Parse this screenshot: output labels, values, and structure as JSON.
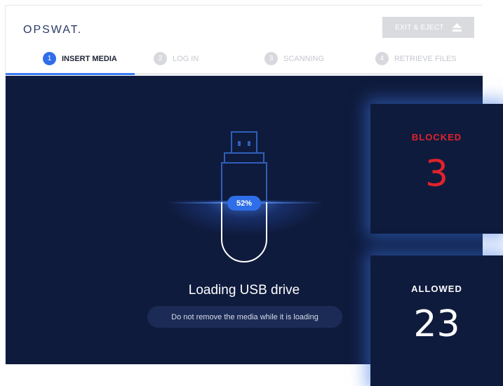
{
  "header": {
    "logo": "OPSWAT.",
    "exit_label": "EXIT & EJECT"
  },
  "steps": [
    {
      "number": "1",
      "label": "INSERT MEDIA",
      "active": true
    },
    {
      "number": "2",
      "label": "LOG IN",
      "active": false
    },
    {
      "number": "3",
      "label": "SCANNING",
      "active": false
    },
    {
      "number": "4",
      "label": "RETRIEVE FILES",
      "active": false
    }
  ],
  "progress": {
    "step_fraction": 0.27
  },
  "main": {
    "percent": "52%",
    "title": "Loading USB drive",
    "note": "Do not remove the media while it is loading"
  },
  "counters": {
    "blocked_label": "BLOCKED",
    "blocked_value": "3",
    "allowed_label": "ALLOWED",
    "allowed_value": "23"
  },
  "colors": {
    "accent": "#2f6ee8",
    "background_dark": "#0f1b3d",
    "blocked": "#e0232b"
  },
  "icons": {
    "exit": "eject-icon",
    "device": "usb-drive-icon"
  }
}
